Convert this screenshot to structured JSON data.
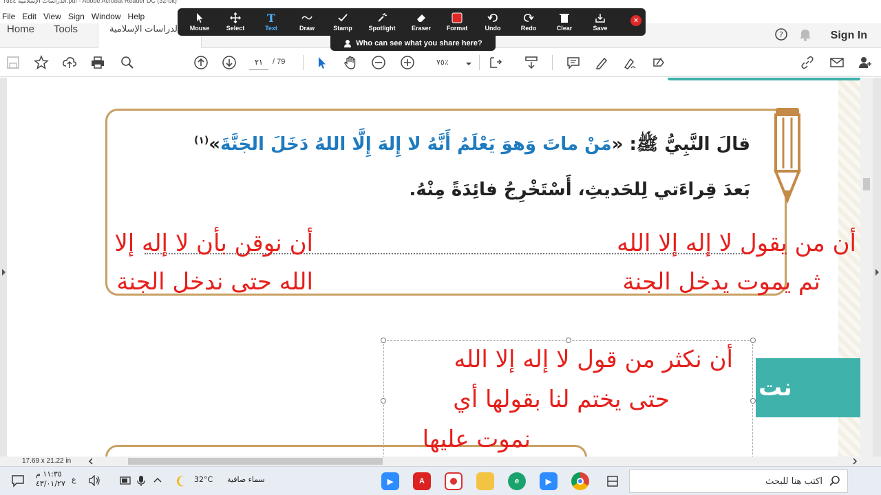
{
  "window": {
    "title": "الدراسات الإسلامية ١٥٤٤.pdf - Adobe Acrobat Reader DC (32-bit)"
  },
  "menu": [
    "File",
    "Edit",
    "View",
    "Sign",
    "Window",
    "Help"
  ],
  "tabs": {
    "home": "Home",
    "tools": "Tools",
    "document": "الدراسات الإسلامية ..."
  },
  "header": {
    "sign_in": "Sign In"
  },
  "toolbar": {
    "page_current": "٢١",
    "page_total": "/ 79",
    "zoom": "٧٥٪"
  },
  "zoom_share": {
    "tools": [
      {
        "label": "Mouse",
        "icon": "cursor-icon"
      },
      {
        "label": "Select",
        "icon": "move-icon"
      },
      {
        "label": "Text",
        "icon": "text-icon"
      },
      {
        "label": "Draw",
        "icon": "draw-icon"
      },
      {
        "label": "Stamp",
        "icon": "check-icon"
      },
      {
        "label": "Spotlight",
        "icon": "spotlight-icon"
      },
      {
        "label": "Eraser",
        "icon": "eraser-icon"
      },
      {
        "label": "Format",
        "icon": "format-icon"
      },
      {
        "label": "Undo",
        "icon": "undo-icon"
      },
      {
        "label": "Redo",
        "icon": "redo-icon"
      },
      {
        "label": "Clear",
        "icon": "trash-icon"
      },
      {
        "label": "Save",
        "icon": "save-icon"
      }
    ],
    "who_can_see": "Who can see what you share here?"
  },
  "document": {
    "hadith_intro": "قالَ النَّبِيُّ ﷺ: «",
    "hadith_quote": "مَنْ ماتَ وَهوَ يَعْلَمُ أَنَّهُ لا إِلهَ إِلَّا اللهُ دَخَلَ الجَنَّةَ",
    "hadith_end": "»",
    "footnote": "(١)",
    "task": "بَعدَ قِراءَتي لِلحَديثِ، أَسْتَخْرِجُ فائِدَةً مِنْهُ.",
    "teal_label": "نت"
  },
  "annotations": {
    "left": [
      "أن نوقن بأن لا إله إلا",
      "الله حتى ندخل الجنة"
    ],
    "right": [
      "أن من يقول لا إله إلا الله",
      "ثم يموت يدخل الجنة"
    ],
    "bottom": [
      "أن نكثر من قول لا إله إلا الله",
      "حتى يختم لنا بقولها أي",
      "نموت عليها"
    ]
  },
  "status": {
    "page_size": "17.69 x 21.22 in"
  },
  "taskbar": {
    "search_placeholder": "اكتب هنا للبحث",
    "weather": "سماء صافية",
    "temperature": "32°C",
    "language": "ع",
    "time": "١١:٣٥ م",
    "date": "٤٣/٠١/٢٧"
  },
  "colors": {
    "annotation_red": "#e5201c",
    "accent_teal": "#3fb2ab",
    "frame_gold": "#c8a062",
    "quote_blue": "#1f7bbf"
  }
}
